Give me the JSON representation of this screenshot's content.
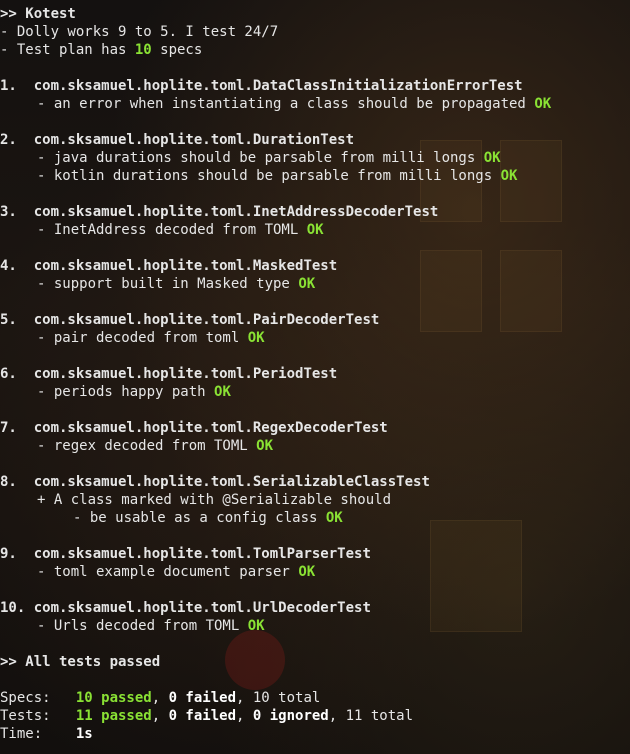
{
  "header": {
    "title": ">> Kotest",
    "tagline": "- Dolly works 9 to 5. I test 24/7",
    "plan_prefix": "- Test plan has ",
    "plan_count": "10",
    "plan_suffix": " specs"
  },
  "ok_label": "OK",
  "specs": [
    {
      "num": "1.  ",
      "name": "com.sksamuel.hoplite.toml.DataClassInitializationErrorTest",
      "tests": [
        "- an error when instantiating a class should be propagated"
      ]
    },
    {
      "num": "2.  ",
      "name": "com.sksamuel.hoplite.toml.DurationTest",
      "tests": [
        "- java durations should be parsable from milli longs",
        "- kotlin durations should be parsable from milli longs"
      ]
    },
    {
      "num": "3.  ",
      "name": "com.sksamuel.hoplite.toml.InetAddressDecoderTest",
      "tests": [
        "- InetAddress decoded from TOML"
      ]
    },
    {
      "num": "4.  ",
      "name": "com.sksamuel.hoplite.toml.MaskedTest",
      "tests": [
        "- support built in Masked type"
      ]
    },
    {
      "num": "5.  ",
      "name": "com.sksamuel.hoplite.toml.PairDecoderTest",
      "tests": [
        "- pair decoded from toml"
      ]
    },
    {
      "num": "6.  ",
      "name": "com.sksamuel.hoplite.toml.PeriodTest",
      "tests": [
        "- periods happy path"
      ]
    },
    {
      "num": "7.  ",
      "name": "com.sksamuel.hoplite.toml.RegexDecoderTest",
      "tests": [
        "- regex decoded from TOML"
      ]
    },
    {
      "num": "8.  ",
      "name": "com.sksamuel.hoplite.toml.SerializableClassTest",
      "context": "+ A class marked with @Serializable should",
      "tests": [
        "- be usable as a config class"
      ]
    },
    {
      "num": "9.  ",
      "name": "com.sksamuel.hoplite.toml.TomlParserTest",
      "tests": [
        "- toml example document parser"
      ]
    },
    {
      "num": "10. ",
      "name": "com.sksamuel.hoplite.toml.UrlDecoderTest",
      "tests": [
        "- Urls decoded from TOML"
      ]
    }
  ],
  "result": ">> All tests passed",
  "summary": {
    "specs": {
      "label": "Specs:   ",
      "passed": "10 passed",
      "sep1": ", ",
      "failed": "0 failed",
      "tail": ", 10 total"
    },
    "tests": {
      "label": "Tests:   ",
      "passed": "11 passed",
      "sep1": ", ",
      "failed": "0 failed",
      "sep2": ", ",
      "ignored": "0 ignored",
      "tail": ", 11 total"
    },
    "time": {
      "label": "Time:    ",
      "value": "1s"
    }
  },
  "colors": {
    "ok": "#8ae234",
    "text": "#e6e6e6",
    "background": "#0d0d0d"
  }
}
